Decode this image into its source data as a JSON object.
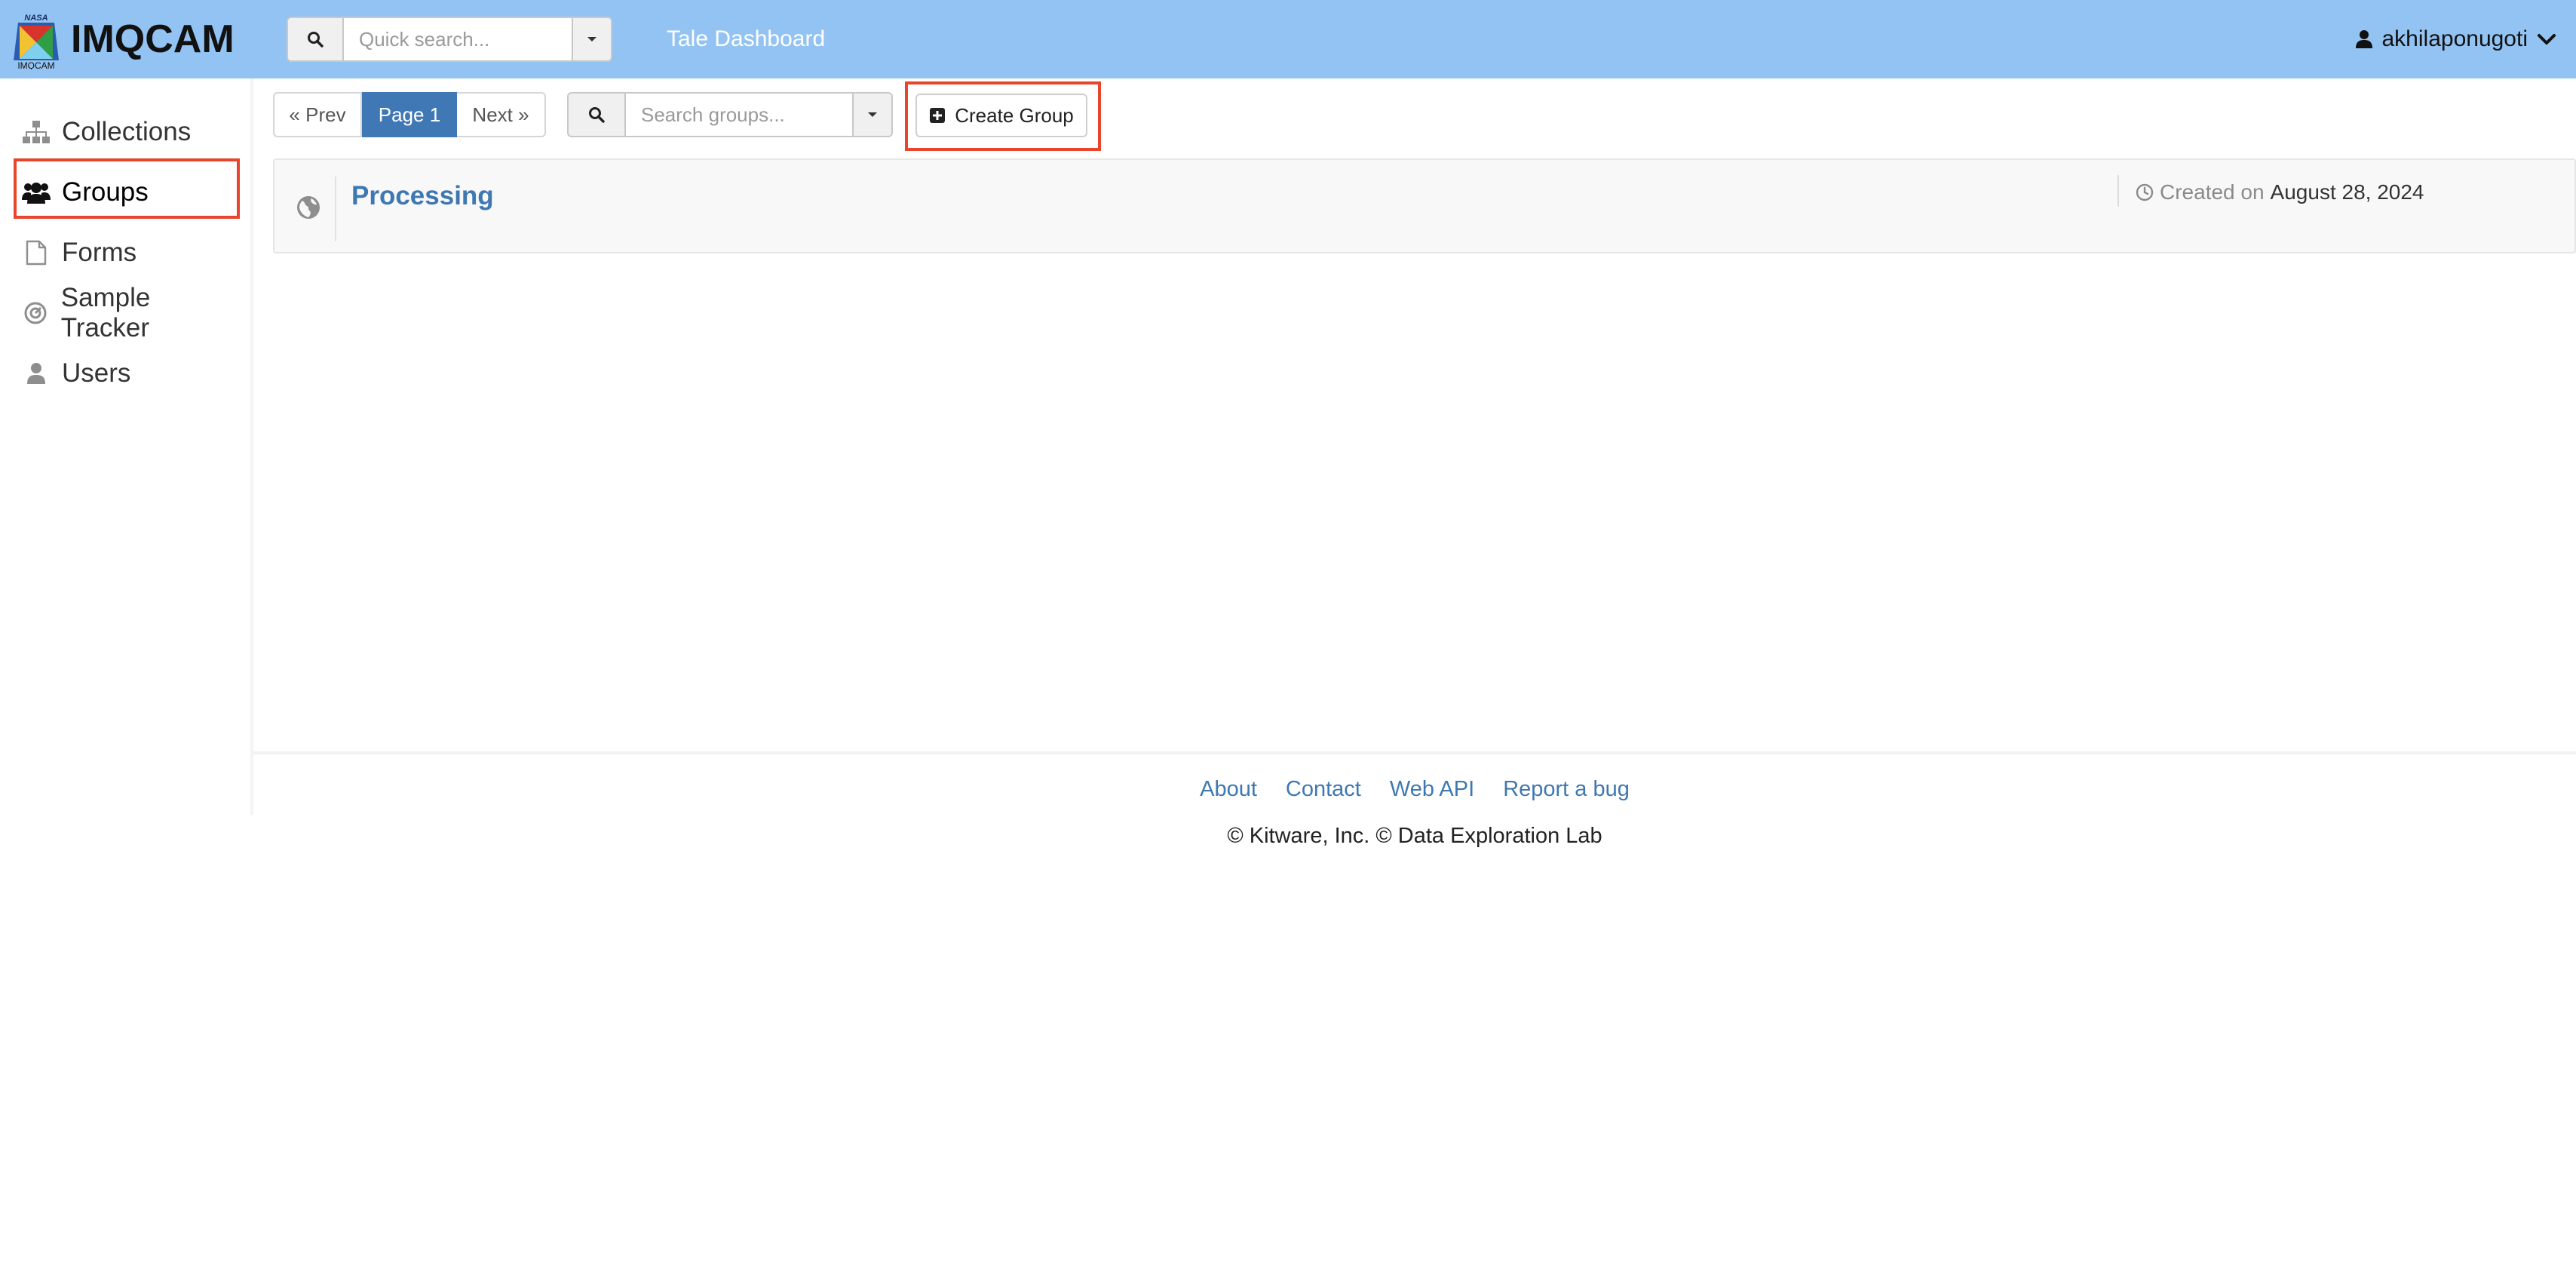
{
  "header": {
    "logo": {
      "small_text_top": "NASA",
      "small_text_bottom": "IMQCAM"
    },
    "brand": "IMQCAM",
    "quick_search": {
      "placeholder": "Quick search...",
      "value": ""
    },
    "dashboard_link": "Tale Dashboard",
    "user": {
      "name": "akhilaponugoti"
    }
  },
  "sidebar": {
    "items": [
      {
        "label": "Collections",
        "icon": "sitemap-icon",
        "active": false
      },
      {
        "label": "Groups",
        "icon": "users-icon",
        "active": true
      },
      {
        "label": "Forms",
        "icon": "file-icon",
        "active": false
      },
      {
        "label": "Sample Tracker",
        "icon": "target-icon",
        "active": false
      },
      {
        "label": "Users",
        "icon": "user-icon",
        "active": false
      }
    ]
  },
  "main": {
    "pagination": {
      "prev": "« Prev",
      "current": "Page 1",
      "next": "Next »"
    },
    "group_search": {
      "placeholder": "Search groups...",
      "value": ""
    },
    "create_button": "Create Group",
    "groups": [
      {
        "name": "Processing",
        "created_label": "Created on",
        "created_date": "August 28, 2024",
        "visibility_icon": "globe-icon"
      }
    ]
  },
  "footer": {
    "links": [
      "About",
      "Contact",
      "Web API",
      "Report a bug"
    ],
    "copyright": "© Kitware, Inc. © Data Exploration Lab"
  },
  "colors": {
    "header_bg": "#93c3f2",
    "accent": "#3f78b4",
    "link": "#3e78b2",
    "highlight_frame": "#e8452c"
  }
}
